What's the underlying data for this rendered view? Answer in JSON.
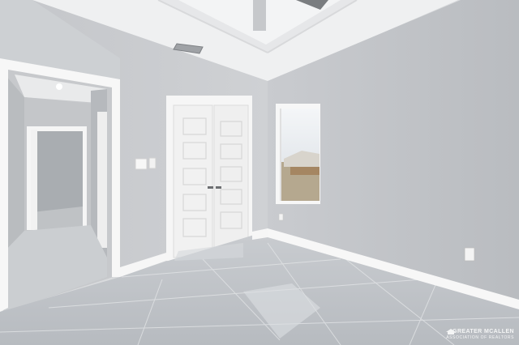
{
  "watermark": {
    "line1": "GREATER MCALLEN",
    "line2": "ASSOCIATION OF REALTORS"
  }
}
